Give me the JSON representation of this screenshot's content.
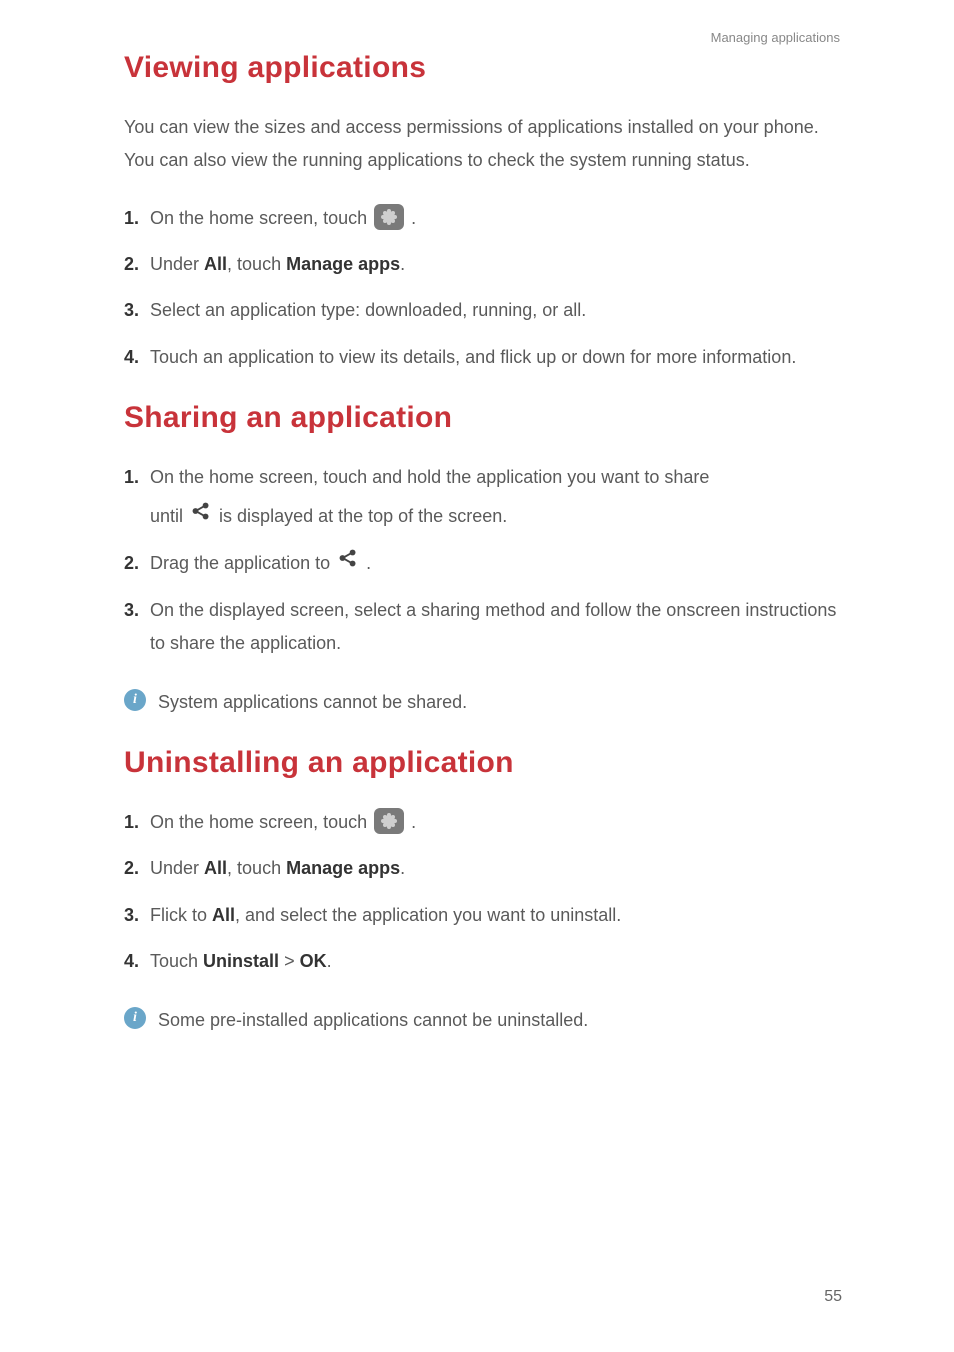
{
  "header": "Managing applications",
  "page_number": "55",
  "icons": {
    "settings": "settings-icon",
    "share": "share-icon",
    "info": "i"
  },
  "inline": {
    "all": "All",
    "manage_apps": "Manage apps",
    "uninstall": "Uninstall",
    "ok": "OK",
    "gt": ">"
  },
  "sec1": {
    "title": "Viewing applications",
    "intro": "You can view the sizes and access permissions of applications installed on your phone. You can also view the running applications to check the system running status.",
    "s1a": "On the home screen, touch ",
    "s1b": " .",
    "s2a": "Under ",
    "s2b": ", touch ",
    "s2c": ".",
    "s3": "Select an application type: downloaded, running, or all.",
    "s4": "Touch an application to view its details, and flick up or down for more information."
  },
  "sec2": {
    "title": "Sharing an application",
    "s1a": "On the home screen, touch and hold the application you want to share",
    "s1b_a": "until ",
    "s1b_b": " is displayed at the top of the screen.",
    "s2a": "Drag the application to ",
    "s2b": " .",
    "s3": "On the displayed screen, select a sharing method and follow the onscreen instructions to share the application.",
    "note": "System applications cannot be shared."
  },
  "sec3": {
    "title": "Uninstalling an application",
    "s1a": "On the home screen, touch ",
    "s1b": " .",
    "s2a": "Under ",
    "s2b": ", touch ",
    "s2c": ".",
    "s3a": "Flick to ",
    "s3b": ", and select the application you want to uninstall.",
    "s4a": "Touch ",
    "s4b": ".",
    "note": "Some pre-installed applications cannot be uninstalled."
  }
}
